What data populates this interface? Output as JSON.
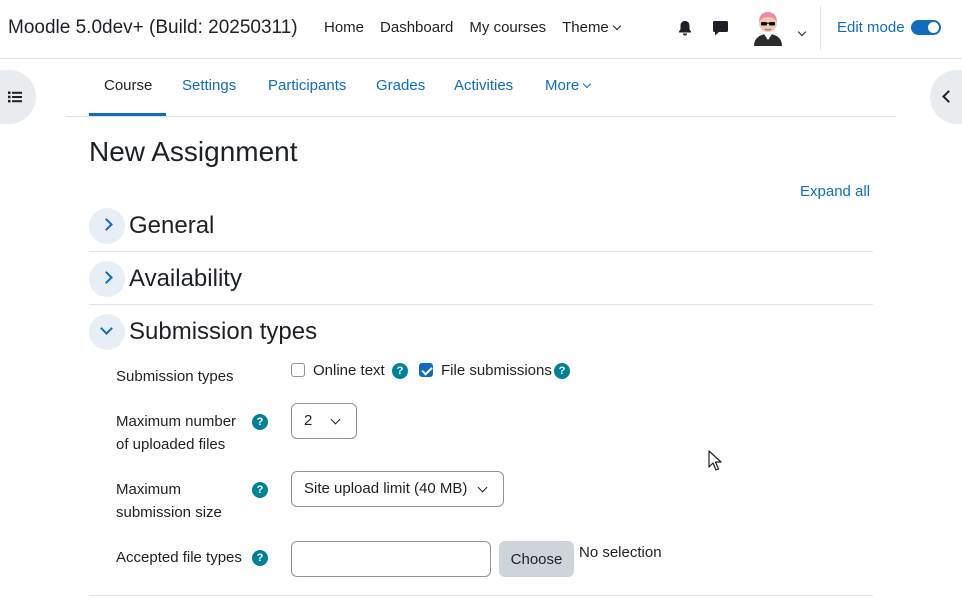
{
  "navbar": {
    "brand": "Moodle 5.0dev+ (Build: 20250311)",
    "links": [
      "Home",
      "Dashboard",
      "My courses",
      "Theme"
    ],
    "edit_mode_label": "Edit mode",
    "edit_mode_on": true
  },
  "secondary_nav": {
    "tabs": [
      "Course",
      "Settings",
      "Participants",
      "Grades",
      "Activities",
      "More"
    ],
    "active": "Course"
  },
  "page": {
    "title": "New Assignment",
    "expand_all": "Expand all"
  },
  "sections": [
    {
      "title": "General",
      "expanded": false
    },
    {
      "title": "Availability",
      "expanded": false
    },
    {
      "title": "Submission types",
      "expanded": true
    }
  ],
  "submission": {
    "types_label": "Submission types",
    "online_text": {
      "label": "Online text",
      "checked": false
    },
    "file_submissions": {
      "label": "File submissions",
      "checked": true
    },
    "max_files_label_1": "Maximum number",
    "max_files_label_2": "of uploaded files",
    "max_files_value": "2",
    "max_size_label_1": "Maximum",
    "max_size_label_2": "submission size",
    "max_size_value": "Site upload limit (40 MB)",
    "file_types_label": "Accepted file types",
    "file_types_value": "",
    "choose_button": "Choose",
    "no_selection": "No selection"
  },
  "help_glyph": "?",
  "colors": {
    "primary": "#0f6cbf",
    "help": "#008196",
    "border": "#dee2e6"
  },
  "icons": [
    "bell-icon",
    "chat-icon",
    "user-avatar",
    "list-icon",
    "chevron-left-icon",
    "help-icon"
  ]
}
